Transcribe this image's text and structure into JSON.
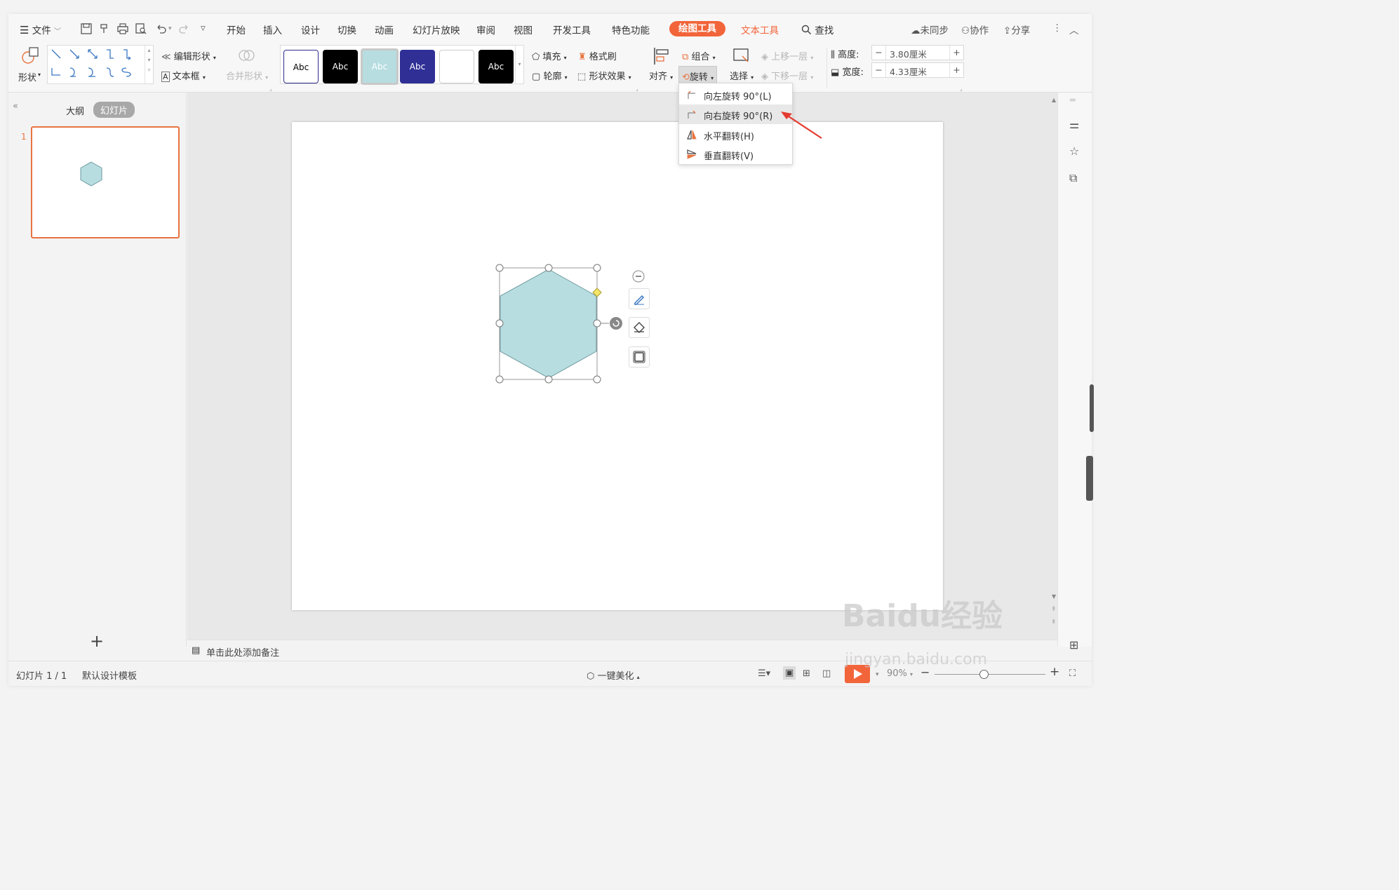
{
  "menubar": {
    "file": "文件",
    "tabs": [
      "开始",
      "插入",
      "设计",
      "切换",
      "动画",
      "幻灯片放映",
      "审阅",
      "视图",
      "开发工具",
      "特色功能"
    ],
    "drawing_tools": "绘图工具",
    "text_tools": "文本工具",
    "find": "查找",
    "unsynced": "未同步",
    "collab": "协作",
    "share": "分享"
  },
  "ribbon": {
    "shape": "形状",
    "edit_shape": "编辑形状",
    "textbox": "文本框",
    "merge_shape": "合并形状",
    "styles": [
      "Abc",
      "Abc",
      "Abc",
      "Abc",
      "",
      "Abc"
    ],
    "fill": "填充",
    "format_painter": "格式刷",
    "outline": "轮廓",
    "shape_effect": "形状效果",
    "align": "对齐",
    "group": "组合",
    "rotate": "旋转",
    "select": "选择",
    "bring_forward": "上移一层",
    "send_backward": "下移一层",
    "height_label": "高度:",
    "height_value": "3.80厘米",
    "width_label": "宽度:",
    "width_value": "4.33厘米"
  },
  "rotate_menu": {
    "items": [
      "向左旋转 90°(L)",
      "向右旋转 90°(R)",
      "水平翻转(H)",
      "垂直翻转(V)"
    ]
  },
  "left_panel": {
    "outline_tab": "大纲",
    "slides_tab": "幻灯片",
    "slide_number": "1",
    "add": "+"
  },
  "notes_placeholder": "单击此处添加备注",
  "status": {
    "slide_info": "幻灯片 1 / 1",
    "template": "默认设计模板",
    "beautify": "一键美化",
    "zoom": "90%"
  },
  "colors": {
    "accent": "#f2643a",
    "hexagon_fill": "#b7dde0",
    "hexagon_stroke": "#6f9aa0",
    "thumb_border": "#e8733f"
  },
  "watermark": {
    "line1": "Baidu经验",
    "line2": "jingyan.baidu.com"
  }
}
